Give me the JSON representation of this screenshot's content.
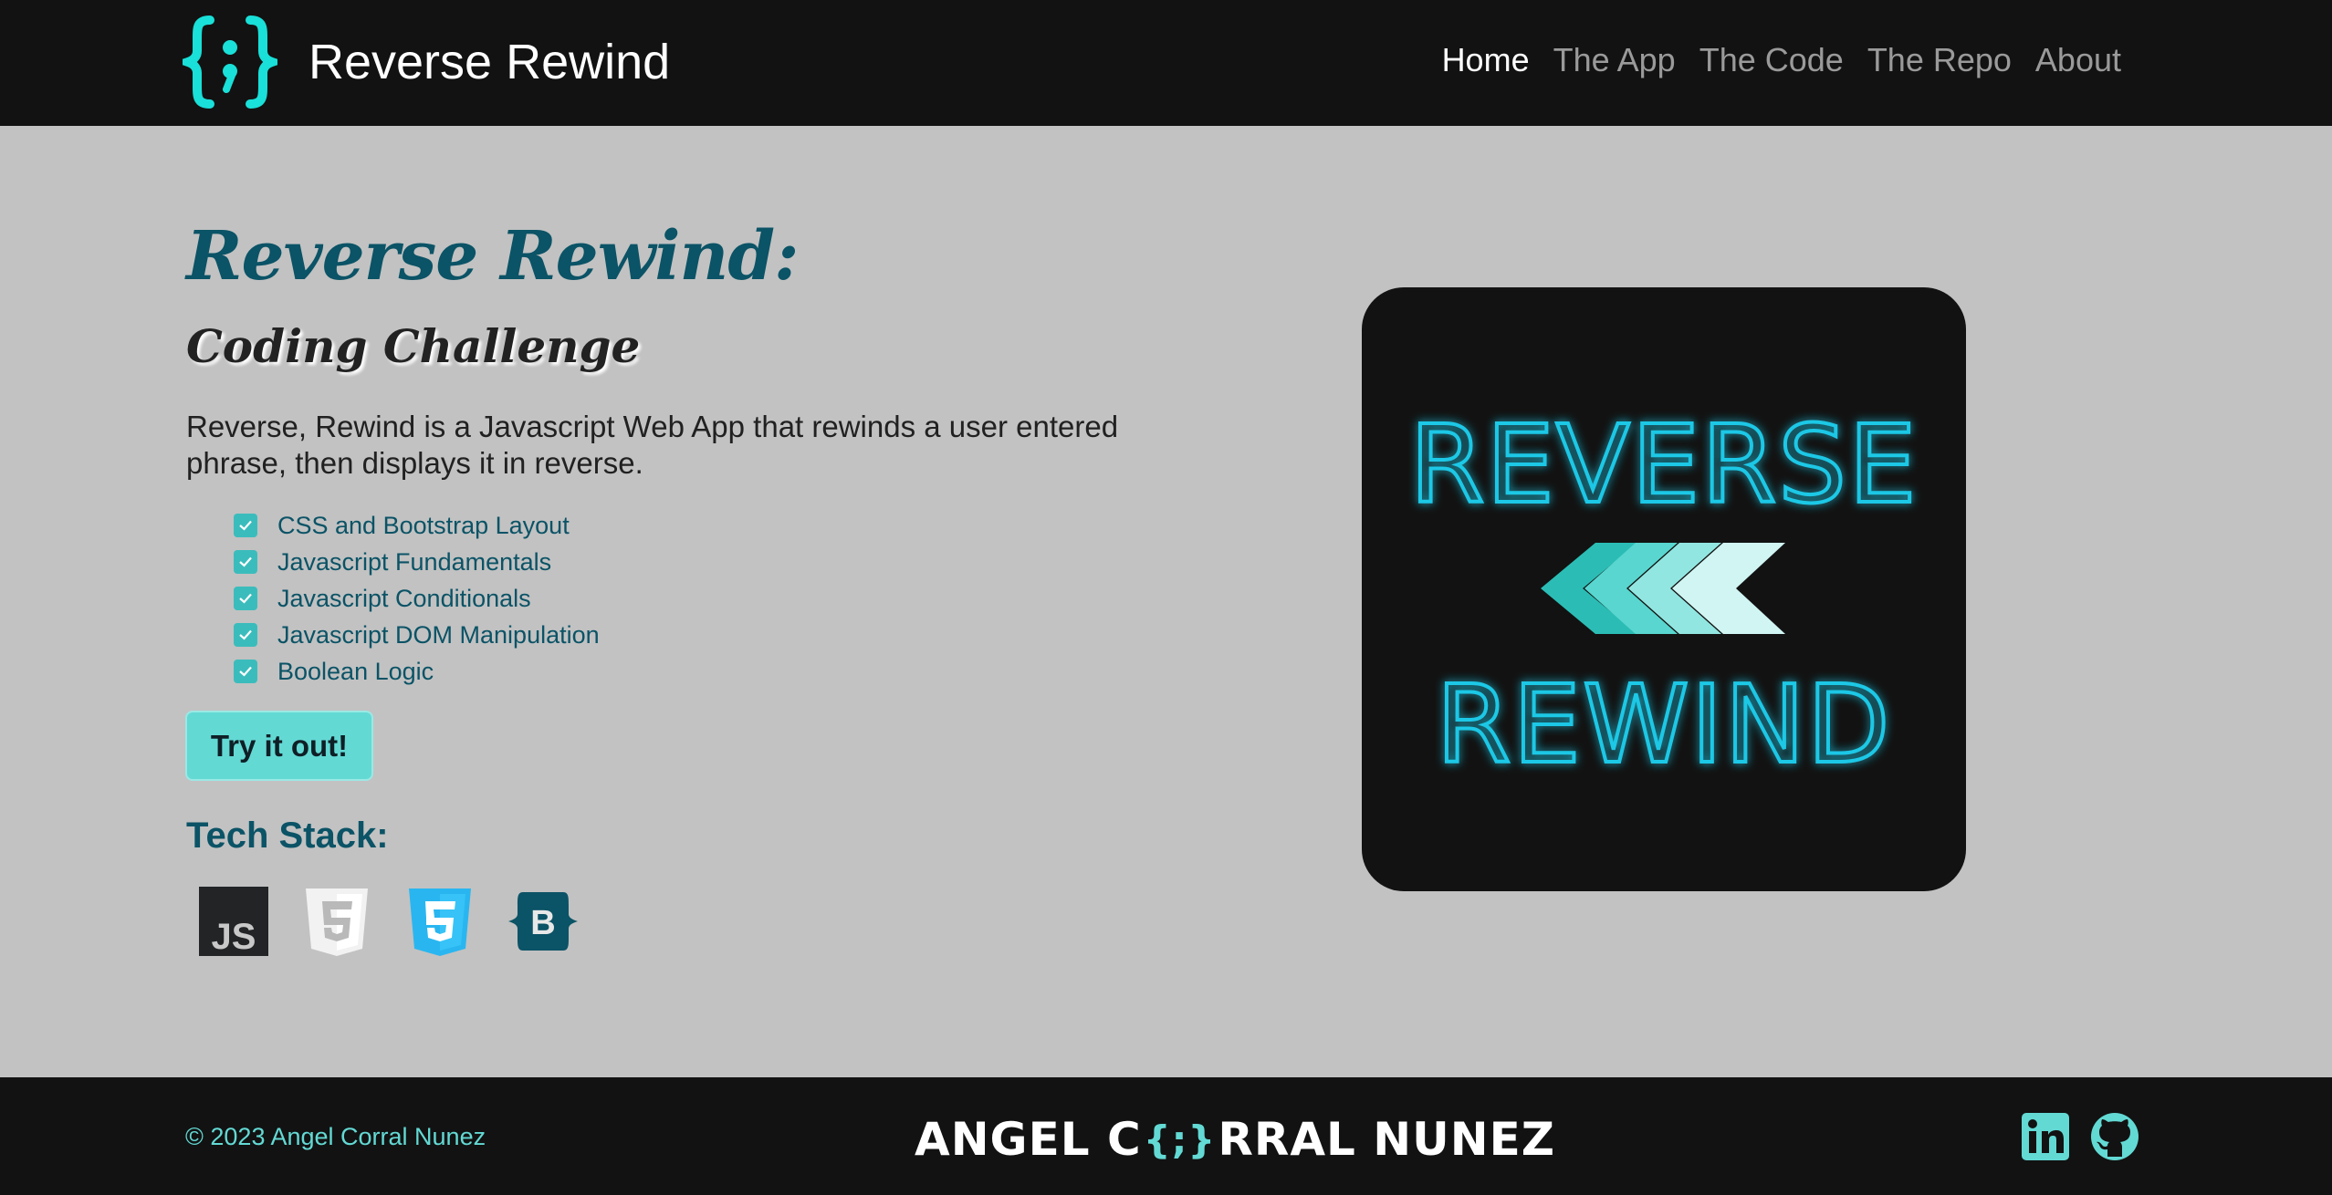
{
  "header": {
    "brand": "Reverse Rewind",
    "logo_icon": "curly-braces-semicolon-icon",
    "nav": [
      {
        "label": "Home",
        "active": true
      },
      {
        "label": "The App",
        "active": false
      },
      {
        "label": "The Code",
        "active": false
      },
      {
        "label": "The Repo",
        "active": false
      },
      {
        "label": "About",
        "active": false
      }
    ]
  },
  "main": {
    "title": "Reverse Rewind:",
    "subtitle": "Coding Challenge",
    "description": "Reverse, Rewind is a Javascript Web App that rewinds a user entered phrase, then displays it in reverse.",
    "features": [
      "CSS and Bootstrap Layout",
      "Javascript Fundamentals",
      "Javascript Conditionals",
      "Javascript DOM Manipulation",
      "Boolean Logic"
    ],
    "cta_label": "Try it out!",
    "tech_stack_title": "Tech Stack:",
    "tech_icons": [
      "javascript-icon",
      "html5-icon",
      "css3-icon",
      "bootstrap-icon"
    ]
  },
  "hero": {
    "line1": "REVERSE",
    "line2": "REWIND",
    "icon": "rewind-arrows-icon"
  },
  "footer": {
    "copyright": "© 2023 Angel Corral Nunez",
    "logo_before": "ANGEL C",
    "logo_brace": "{;}",
    "logo_after": "RRAL NUNEZ",
    "socials": [
      "linkedin-icon",
      "github-icon"
    ]
  },
  "colors": {
    "accent": "#63d9d4",
    "heading": "#0b5366",
    "dark": "#121212",
    "background": "#c2c2c2"
  }
}
